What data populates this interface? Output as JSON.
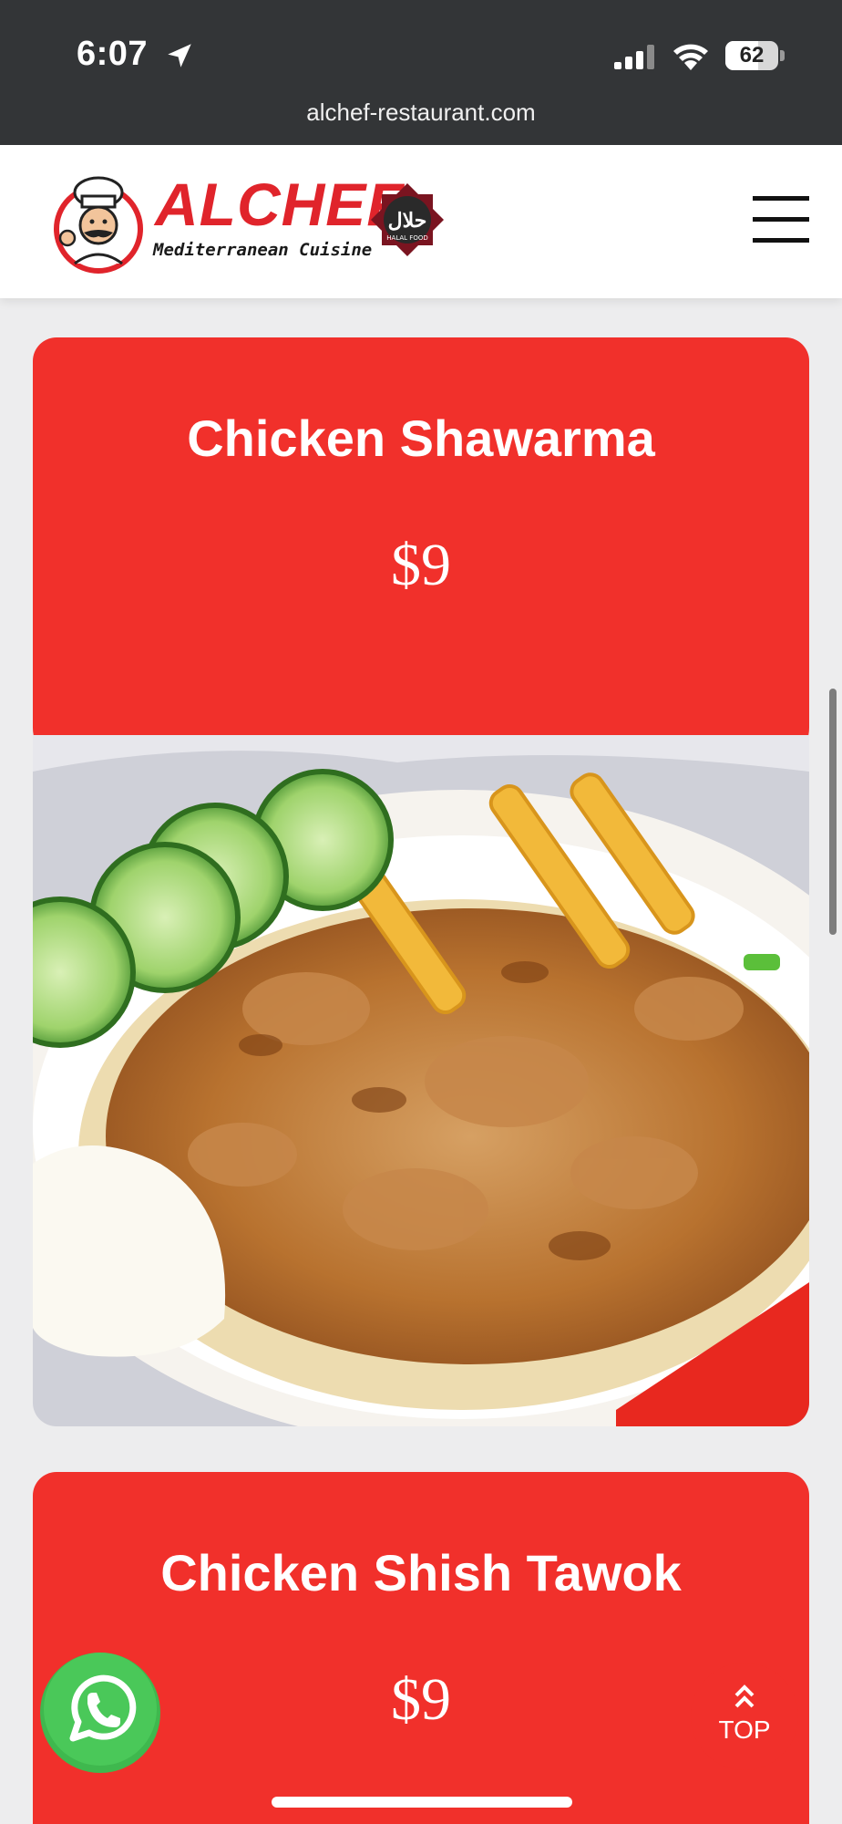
{
  "status_bar": {
    "time": "6:07",
    "battery_percent": "62",
    "battery_level": 0.62,
    "icons": [
      "location-arrow-icon",
      "cellular-signal-icon",
      "wifi-icon",
      "battery-icon"
    ]
  },
  "browser": {
    "url": "alchef-restaurant.com"
  },
  "header": {
    "brand": "ALCHEF",
    "tagline": "Mediterranean Cuisine",
    "halal_badge": "حلال",
    "halal_caption": "HALAL FOOD",
    "menu_icon": "hamburger-menu-icon"
  },
  "menu_items": [
    {
      "title": "Chicken Shawarma",
      "price": "$9"
    },
    {
      "title": "Chicken Shish Tawok",
      "price": "$9"
    }
  ],
  "floating": {
    "whatsapp_icon": "whatsapp-icon",
    "top_label": "TOP"
  },
  "colors": {
    "accent_red": "#f1302b",
    "status_bar_bg": "#333537",
    "whatsapp_green": "#4ac859"
  }
}
